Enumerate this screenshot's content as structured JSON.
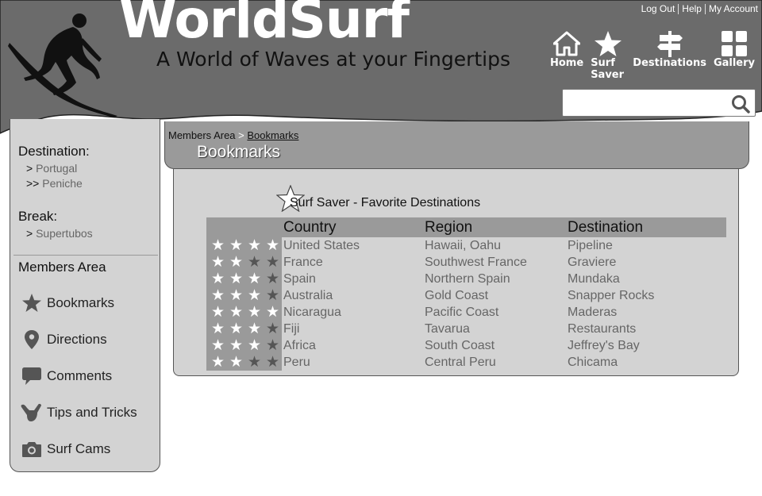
{
  "brand": {
    "logo": "WorldSurf",
    "tagline": "A World of Waves at your Fingertips"
  },
  "top_links": [
    "Log Out",
    "Help",
    "My Account"
  ],
  "nav": [
    {
      "label": "Home",
      "icon": "home-icon"
    },
    {
      "label": "Surf Saver",
      "icon": "star-icon"
    },
    {
      "label": "Destinations",
      "icon": "signpost-icon"
    },
    {
      "label": "Gallery",
      "icon": "gallery-icon"
    }
  ],
  "search": {
    "placeholder": "",
    "icon": "search-icon"
  },
  "sidebar": {
    "destination_heading": "Destination:",
    "destination_items": [
      {
        "prefix": ">",
        "label": "Portugal"
      },
      {
        "prefix": ">>",
        "label": "Peniche"
      }
    ],
    "break_heading": "Break:",
    "break_items": [
      {
        "prefix": ">",
        "label": "Supertubos"
      }
    ],
    "members_heading": "Members Area",
    "members_items": [
      {
        "label": "Bookmarks",
        "icon": "star-icon"
      },
      {
        "label": "Directions",
        "icon": "map-pin-icon"
      },
      {
        "label": "Comments",
        "icon": "speech-bubble-icon"
      },
      {
        "label": "Tips and Tricks",
        "icon": "shaka-hand-icon"
      },
      {
        "label": "Surf Cams",
        "icon": "camera-icon"
      }
    ]
  },
  "breadcrumb": {
    "root": "Members Area",
    "separator": ">",
    "current": "Bookmarks"
  },
  "page_title": "Bookmarks",
  "favorites": {
    "title": "Surf Saver - Favorite Destinations",
    "columns": [
      "Country",
      "Region",
      "Destination"
    ],
    "rows": [
      {
        "rating": 4,
        "country": "United States",
        "region": "Hawaii, Oahu",
        "destination": "Pipeline"
      },
      {
        "rating": 2,
        "country": "France",
        "region": "Southwest France",
        "destination": "Graviere"
      },
      {
        "rating": 3,
        "country": "Spain",
        "region": "Northern Spain",
        "destination": "Mundaka"
      },
      {
        "rating": 3,
        "country": "Australia",
        "region": "Gold Coast",
        "destination": "Snapper Rocks"
      },
      {
        "rating": 4,
        "country": "Nicaragua",
        "region": "Pacific Coast",
        "destination": "Maderas"
      },
      {
        "rating": 3,
        "country": "Fiji",
        "region": "Tavarua",
        "destination": "Restaurants"
      },
      {
        "rating": 3,
        "country": "Africa",
        "region": "South Coast",
        "destination": "Jeffrey's Bay"
      },
      {
        "rating": 2,
        "country": "Peru",
        "region": "Central Peru",
        "destination": "Chicama"
      }
    ],
    "max_rating": 4
  },
  "colors": {
    "header": "#6b6b6b",
    "panel": "#d3d3d3",
    "accent": "#9a9a9a"
  }
}
